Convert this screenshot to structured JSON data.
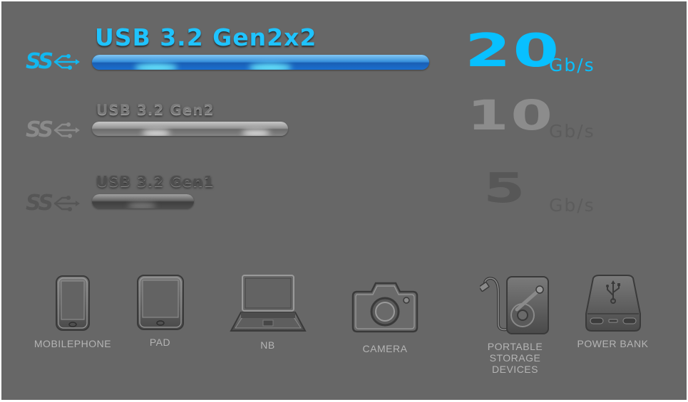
{
  "speed_tiers": [
    {
      "id": "gen2x2",
      "logo_text": "SS",
      "logo_icon": "superspeed-usb-trident-icon",
      "label": "USB 3.2 Gen2x2",
      "speed_value": "20",
      "speed_unit": "Gb/s",
      "bar_relative_length": 1.0,
      "color": "#08c0ff",
      "state": "highlighted"
    },
    {
      "id": "gen2",
      "logo_text": "SS",
      "logo_icon": "superspeed-usb-trident-icon",
      "label": "USB 3.2 Gen2",
      "speed_value": "10",
      "speed_unit": "Gb/s",
      "bar_relative_length": 0.5,
      "color": "#8c8c8c",
      "state": "dimmed"
    },
    {
      "id": "gen1",
      "logo_text": "SS",
      "logo_icon": "superspeed-usb-trident-icon",
      "label": "USB 3.2 Gen1",
      "speed_value": "5",
      "speed_unit": "Gb/s",
      "bar_relative_length": 0.25,
      "color": "#575757",
      "state": "dimmed"
    }
  ],
  "devices": [
    {
      "label": "MOBILEPHONE",
      "icon": "mobile-phone-icon"
    },
    {
      "label": "PAD",
      "icon": "tablet-icon"
    },
    {
      "label": "NB",
      "icon": "laptop-icon"
    },
    {
      "label": "CAMERA",
      "icon": "camera-icon"
    },
    {
      "label": "PORTABLE\nSTORAGE\nDEVICES",
      "icon": "portable-storage-icon"
    },
    {
      "label": "POWER BANK",
      "icon": "power-bank-icon"
    }
  ],
  "colors": {
    "background": "#676767",
    "accent": "#08c0ff",
    "device_label": "#b4b4b4"
  }
}
